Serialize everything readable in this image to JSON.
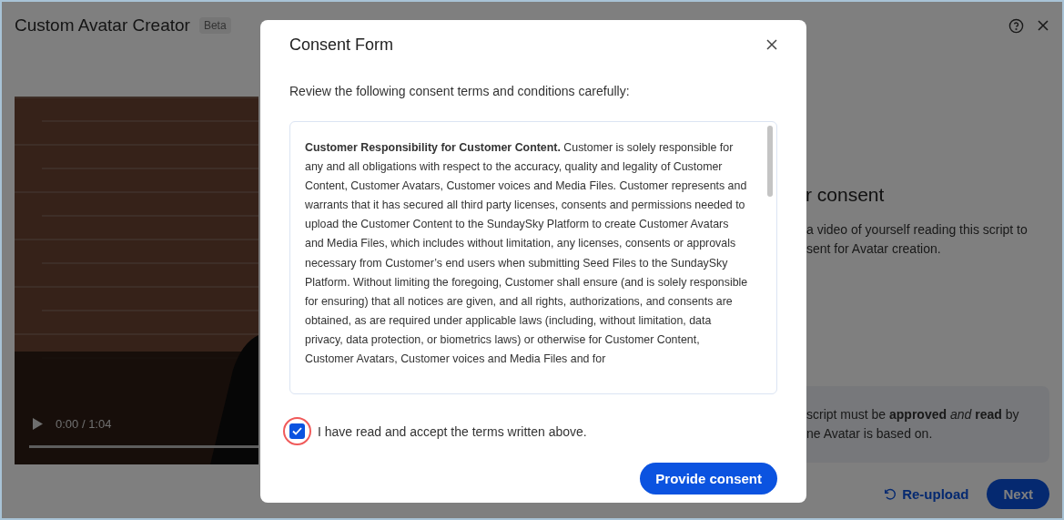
{
  "app": {
    "title": "Custom Avatar Creator",
    "badge": "Beta"
  },
  "video": {
    "time": "0:00 / 1:04",
    "level": 0
  },
  "panel": {
    "heading": "r consent",
    "lines": [
      "a video of yourself reading this script to",
      "sent for Avatar creation."
    ],
    "notice_lines": [
      "script must be **approved** *and* **read** by",
      "ne Avatar is based on."
    ],
    "buttons": [
      {
        "kind": "link",
        "label": "Re-upload"
      },
      {
        "kind": "primary",
        "label": "Next"
      }
    ]
  },
  "modal": {
    "title": "Consent Form",
    "intro": "Review the following consent terms and conditions carefully:",
    "terms": "**Customer Responsibility for Customer Content.** Customer is solely responsible for any and all obligations with respect to the accuracy, quality and legality of Customer Content, Customer Avatars, Customer voices and Media Files. Customer represents and warrants that it has secured all third party licenses, consents and permissions needed to upload the Customer Content to the SundaySky Platform to create Customer Avatars and Media Files, which includes without limitation, any licenses, consents or approvals necessary from Customer’s end users when submitting Seed Files to the SundaySky Platform. Without limiting the foregoing, Customer shall ensure (and is solely responsible for ensuring) that all notices are given, and all rights, authorizations, and consents are obtained, as are required under applicable laws (including, without limitation, data privacy, data protection, or biometrics laws) or otherwise for Customer Content, Customer Avatars, Customer voices and Media Files and for",
    "checkbox": {
      "label": "I have read and accept the terms written above.",
      "checked": true,
      "highlighted": true
    },
    "button": "Provide consent"
  }
}
